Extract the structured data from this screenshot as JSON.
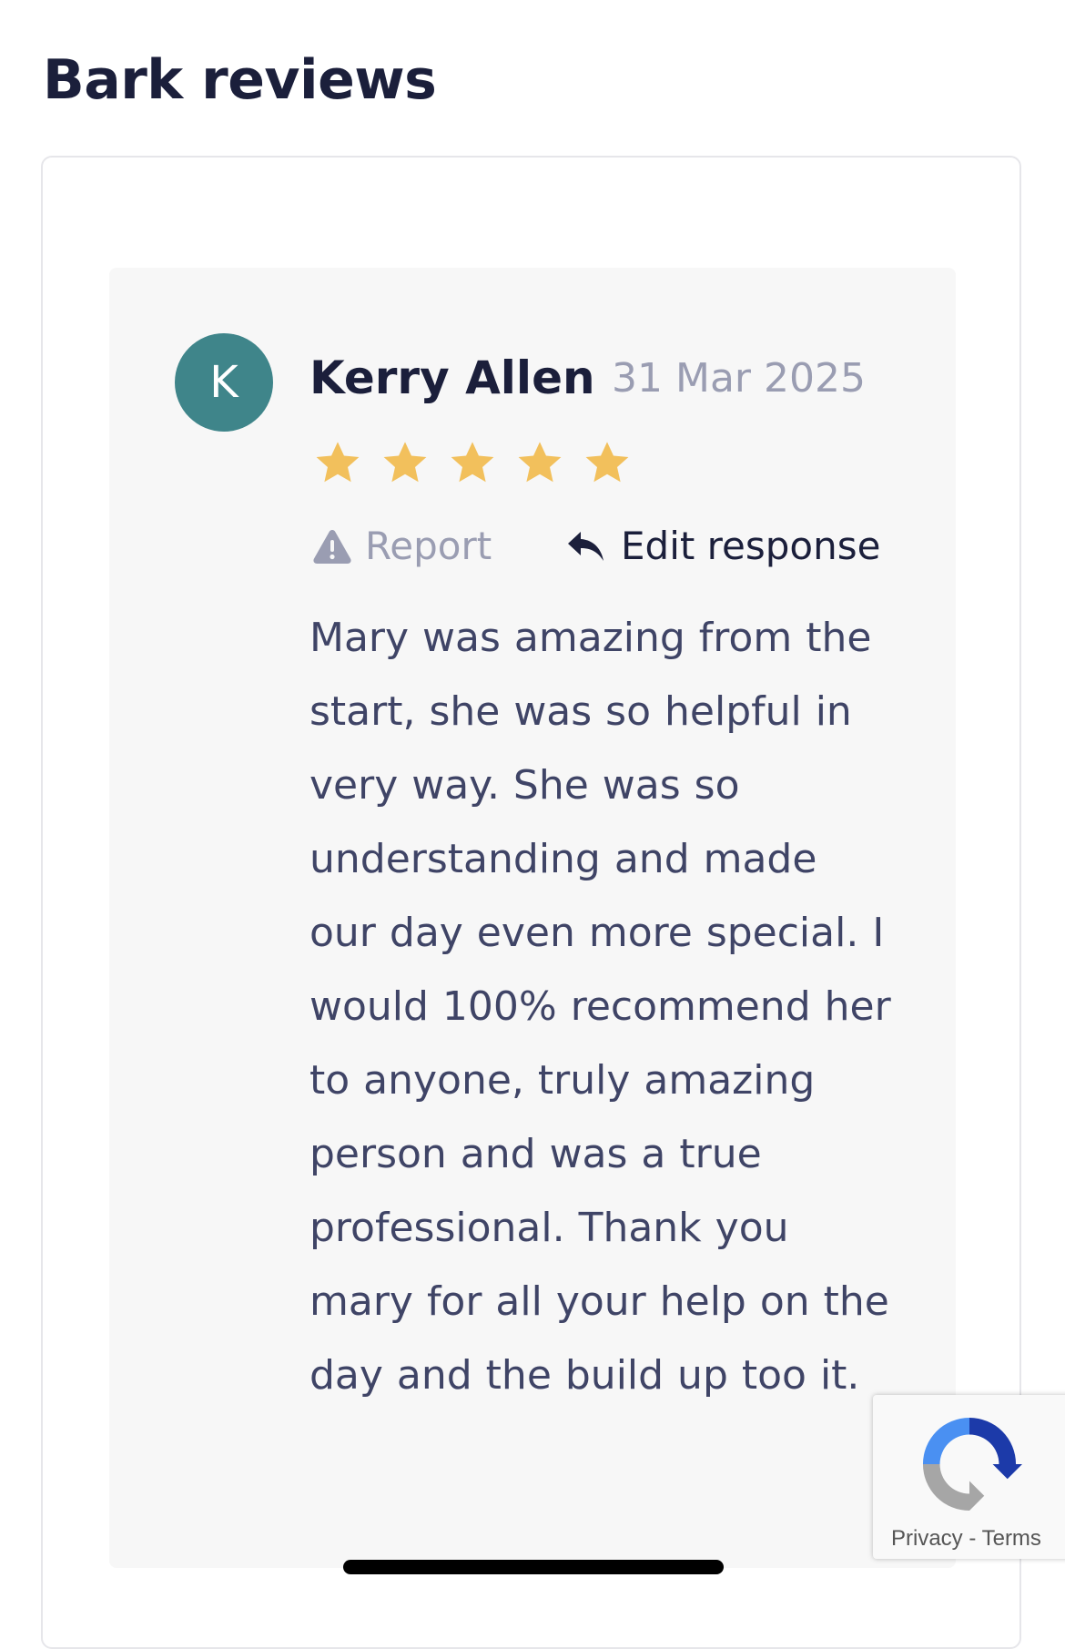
{
  "page": {
    "title": "Bark reviews"
  },
  "review": {
    "avatar_initial": "K",
    "avatar_color": "#3f858a",
    "reviewer_name": "Kerry Allen",
    "date": "31 Mar 2025",
    "rating": 5,
    "rating_max": 5,
    "star_color": "#f2c05c",
    "actions": {
      "report_label": "Report",
      "report_icon": "warning-triangle-icon",
      "edit_response_label": "Edit response",
      "edit_response_icon": "reply-arrow-icon"
    },
    "body": "Mary was amazing from the start, she was so helpful in very way. She was so understanding and made our day even more special. I would 100% recommend her to anyone, truly amazing person and was a true professional. Thank you mary for all your help on the day and the build up too it."
  },
  "recaptcha": {
    "logo_icon": "recaptcha-icon",
    "privacy_label": "Privacy",
    "separator": "-",
    "terms_label": "Terms"
  },
  "colors": {
    "heading": "#1b1f3b",
    "muted": "#9a9db2",
    "body_text": "#3f4466",
    "card_background": "#f7f7f7"
  }
}
